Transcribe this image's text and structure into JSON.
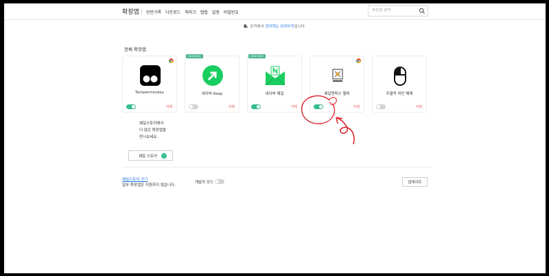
{
  "header": {
    "title": "확장앱",
    "nav": [
      "방문기록",
      "다운로드",
      "북마크",
      "탭랩",
      "설정",
      "비밀번호"
    ],
    "search_placeholder": "확장앱 검색"
  },
  "notice": {
    "prefix": "조직에서 ",
    "link": "관리하는 브라우저",
    "suffix": "입니다."
  },
  "section_title": "전체 확장앱",
  "extensions": [
    {
      "name": "Tampermonkey",
      "badge": "",
      "chrome_icon": true,
      "enabled": true,
      "delete_label": "삭제"
    },
    {
      "name": "네이버 Keep",
      "badge": "DESIGNED",
      "chrome_icon": false,
      "enabled": false,
      "delete_label": "삭제"
    },
    {
      "name": "네이버 메일",
      "badge": "DESIGNED",
      "chrome_icon": false,
      "enabled": true,
      "delete_label": "삭제"
    },
    {
      "name": "웨일캔퍼스 헬퍼",
      "badge": "",
      "chrome_icon": true,
      "enabled": true,
      "delete_label": "삭제"
    },
    {
      "name": "우클릭 차단 해제",
      "badge": "",
      "chrome_icon": false,
      "enabled": false,
      "delete_label": "삭제"
    }
  ],
  "store_promo": {
    "line1": "웨일스토어에서",
    "line2": "더 많은 확장앱을",
    "line3": "만나보세요.",
    "button": "웨일 스토어"
  },
  "footer": {
    "link": "웨일스토어 가기",
    "note": "일부 확장앱은 지원하지 않습니다.",
    "dev_mode_label": "개발자 모드",
    "dev_mode_enabled": false,
    "update_button": "업데이트"
  },
  "colors": {
    "toggle_on": "#34bd8e",
    "toggle_off": "#d3d3d3",
    "delete": "#e85a5a",
    "link": "#1a73e8",
    "annotation": "#d9252b"
  }
}
